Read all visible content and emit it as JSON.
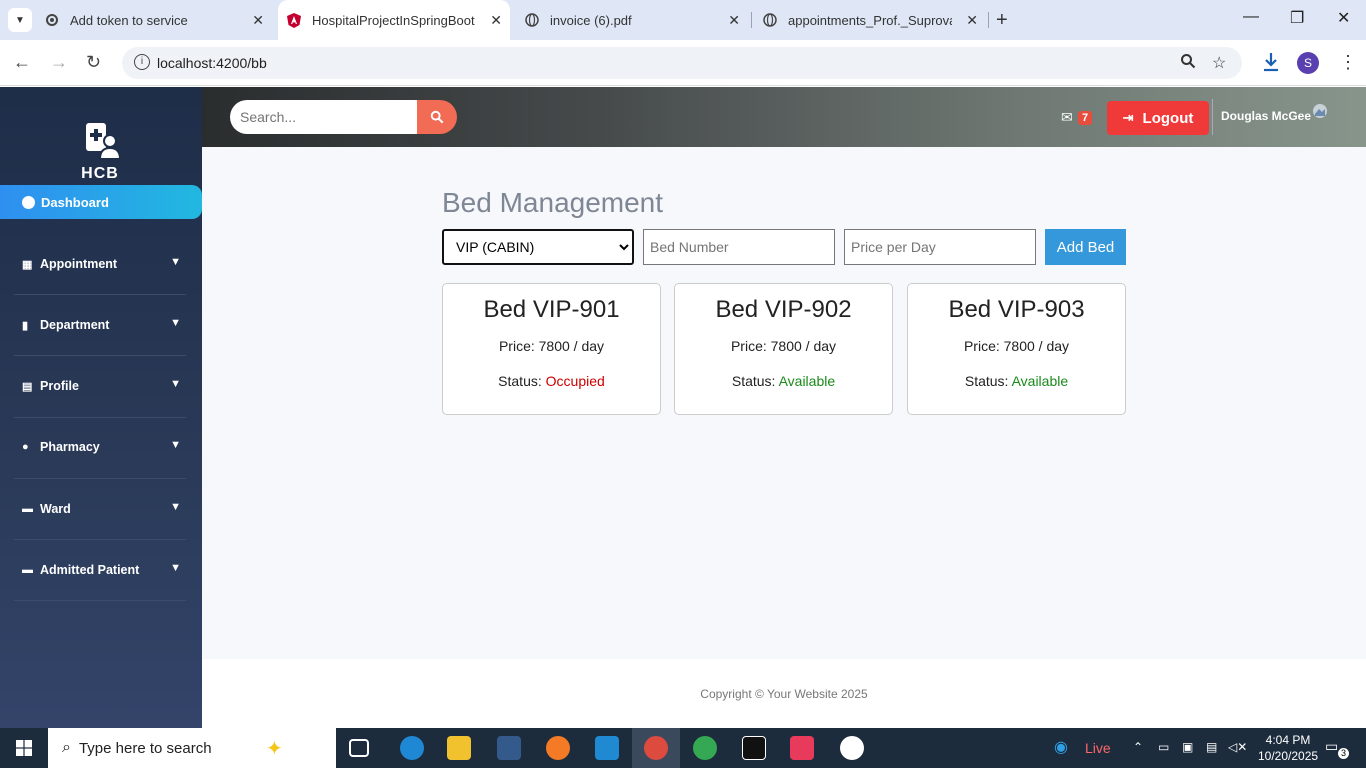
{
  "browser": {
    "tabs": [
      {
        "title": "Add token to service",
        "icon": "gear-icon",
        "active": false
      },
      {
        "title": "HospitalProjectInSpringBoot",
        "icon": "angular-icon",
        "active": true
      },
      {
        "title": "invoice (6).pdf",
        "icon": "globe-icon",
        "active": false
      },
      {
        "title": "appointments_Prof._Suprova_Si",
        "icon": "globe-icon",
        "active": false
      }
    ],
    "url": "localhost:4200/bb",
    "profile_initial": "S"
  },
  "sidebar": {
    "brand": "HCB",
    "dashboard_label": "Dashboard",
    "items": [
      {
        "label": "Appointment",
        "icon": "calendar-icon"
      },
      {
        "label": "Department",
        "icon": "building-icon"
      },
      {
        "label": "Profile",
        "icon": "id-card-icon"
      },
      {
        "label": "Pharmacy",
        "icon": "pills-icon"
      },
      {
        "label": "Ward",
        "icon": "bed-icon"
      },
      {
        "label": "Admitted Patient",
        "icon": "bed-icon"
      }
    ]
  },
  "topbar": {
    "search_placeholder": "Search...",
    "mail_count": "7",
    "logout_label": "Logout",
    "username": "Douglas McGee"
  },
  "main": {
    "title": "Bed Management",
    "form": {
      "bed_type_selected": "VIP (CABIN)",
      "bed_number_placeholder": "Bed Number",
      "price_placeholder": "Price per Day",
      "add_button": "Add Bed"
    },
    "beds": [
      {
        "name": "Bed VIP-901",
        "price": "Price: 7800 / day",
        "status_label": "Status:",
        "status": "Occupied",
        "status_color": "#cc0000"
      },
      {
        "name": "Bed VIP-902",
        "price": "Price: 7800 / day",
        "status_label": "Status:",
        "status": "Available",
        "status_color": "#1a8a1a"
      },
      {
        "name": "Bed VIP-903",
        "price": "Price: 7800 / day",
        "status_label": "Status:",
        "status": "Available",
        "status_color": "#1a8a1a"
      }
    ]
  },
  "footer": {
    "copyright": "Copyright © Your Website 2025"
  },
  "taskbar": {
    "search_placeholder": "Type here to search",
    "weather_label": "Live",
    "time": "4:04 PM",
    "date": "10/20/2025",
    "notification_count": "3"
  }
}
